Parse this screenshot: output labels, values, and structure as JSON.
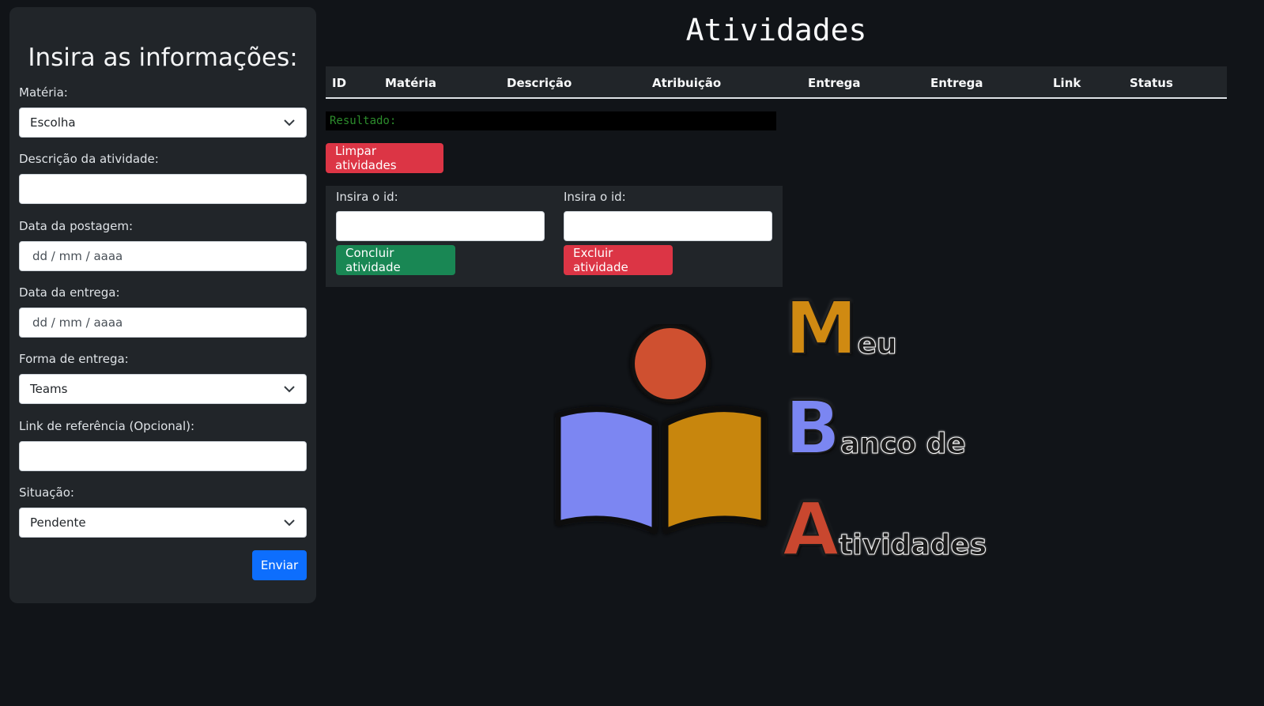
{
  "form": {
    "title": "Insira as informações:",
    "materia_label": "Matéria:",
    "materia_value": "Escolha",
    "descricao_label": "Descrição da atividade:",
    "descricao_value": "",
    "postagem_label": "Data da postagem:",
    "postagem_value": "dd / mm / aaaa",
    "entrega_label": "Data da entrega:",
    "entrega_value": "dd / mm / aaaa",
    "forma_label": "Forma de entrega:",
    "forma_value": "Teams",
    "link_label": "Link de referência (Opcional):",
    "link_value": "",
    "situacao_label": "Situação:",
    "situacao_value": "Pendente",
    "submit_label": "Enviar"
  },
  "main": {
    "title": "Atividades",
    "table_headers": [
      "ID",
      "Matéria",
      "Descrição",
      "Atribuição",
      "Entrega",
      "Entrega",
      "Link",
      "Status"
    ],
    "result_text": "Resultado:",
    "clear_label": "Limpar atividades",
    "conclude": {
      "label": "Insira o id:",
      "value": "",
      "button_label": "Concluir atividade"
    },
    "delete": {
      "label": "Insira o id:",
      "value": "",
      "button_label": "Excluir atividade"
    }
  },
  "logo": {
    "line1_letter": "M",
    "line1_rest": "eu",
    "line2_letter": "B",
    "line2_rest": "anco de",
    "line3_letter": "A",
    "line3_rest": "tividades",
    "colors": {
      "m": "#d08a12",
      "b": "#7b86f2",
      "a": "#c9472f",
      "head": "#cf5030",
      "left_page": "#7b86f2",
      "right_page": "#c8860a"
    }
  },
  "icons": {
    "select_chevron": "chevron-down-icon",
    "logo_reader": "reader-book-icon"
  }
}
